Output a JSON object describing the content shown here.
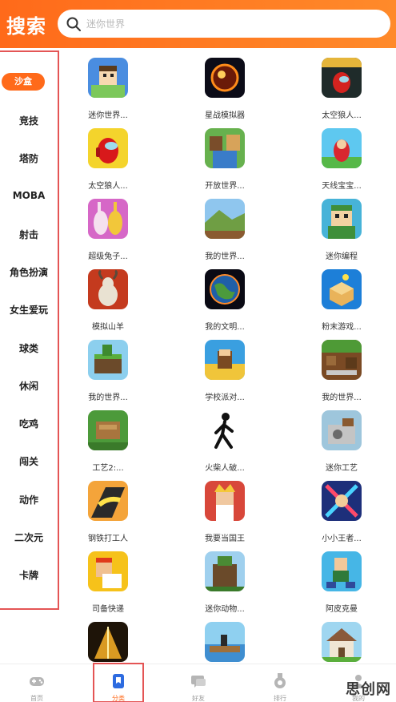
{
  "header": {
    "title": "搜索",
    "search_placeholder": "迷你世界"
  },
  "categories": [
    "沙盒",
    "竞技",
    "塔防",
    "MOBA",
    "射击",
    "角色扮演",
    "女生爱玩",
    "球类",
    "休闲",
    "吃鸡",
    "闯关",
    "动作",
    "二次元",
    "卡牌"
  ],
  "games": [
    {
      "name": "迷你世界...",
      "icon": "blocky-character-icon"
    },
    {
      "name": "星战模拟器",
      "icon": "planet-explosion-icon"
    },
    {
      "name": "太空狼人...",
      "icon": "red-crewmate-lobby-icon"
    },
    {
      "name": "太空狼人...",
      "icon": "red-crewmate-icon"
    },
    {
      "name": "开放世界...",
      "icon": "blocky-heroes-icon"
    },
    {
      "name": "天线宝宝...",
      "icon": "teletubby-icon"
    },
    {
      "name": "超级兔子...",
      "icon": "bunny-characters-icon"
    },
    {
      "name": "我的世界...",
      "icon": "block-landscape-icon"
    },
    {
      "name": "迷你编程",
      "icon": "blocky-head-icon"
    },
    {
      "name": "模拟山羊",
      "icon": "goat-icon"
    },
    {
      "name": "我的文明...",
      "icon": "earth-icon"
    },
    {
      "name": "粉末游戏...",
      "icon": "sandbox-box-icon"
    },
    {
      "name": "我的世界...",
      "icon": "block-island-icon"
    },
    {
      "name": "学校派对...",
      "icon": "school-party-icon"
    },
    {
      "name": "我的世界...",
      "icon": "pocket-edition-icon"
    },
    {
      "name": "工艺2:...",
      "icon": "craft-island-icon"
    },
    {
      "name": "火柴人破...",
      "icon": "stickman-icon"
    },
    {
      "name": "迷你工艺",
      "icon": "mini-craft-icon"
    },
    {
      "name": "钢铁打工人",
      "icon": "stacking-road-icon"
    },
    {
      "name": "我要当国王",
      "icon": "king-icon"
    },
    {
      "name": "小小王者...",
      "icon": "mini-heroes-icon"
    },
    {
      "name": "司备快递",
      "icon": "courier-icon"
    },
    {
      "name": "迷你动物...",
      "icon": "block-tower-icon"
    },
    {
      "name": "阿皮克曼",
      "icon": "blocky-runner-icon"
    },
    {
      "name": "",
      "icon": "mine-cart-icon"
    },
    {
      "name": "",
      "icon": "raft-icon"
    },
    {
      "name": "",
      "icon": "house-icon"
    }
  ],
  "nav": [
    {
      "label": "首页",
      "icon": "gamepad-icon"
    },
    {
      "label": "分类",
      "icon": "bookmark-icon"
    },
    {
      "label": "好友",
      "icon": "chat-icon"
    },
    {
      "label": "排行",
      "icon": "medal-icon"
    },
    {
      "label": "我的",
      "icon": "user-icon"
    }
  ],
  "watermark": "思创网",
  "colors": {
    "accent": "#ff6a1a",
    "highlight_border": "#e45555"
  }
}
